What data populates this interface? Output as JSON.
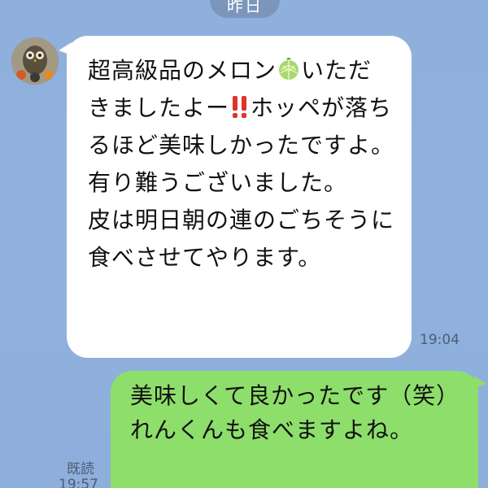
{
  "date_separator": "昨日",
  "incoming": {
    "text_part1": "超高級品のメロン",
    "emoji1": "melon-icon",
    "text_part2": "いただきましたよー",
    "emoji2": "double-exclamation-icon",
    "text_part3": "ホッペが落ちるほど美味しかったですよ。有り難うございました。\n皮は明日朝の連のごちそうに食べさせてやります。",
    "time": "19:04"
  },
  "outgoing": {
    "text": "美味しくて良かったです（笑）\nれんくんも食べますよね。",
    "read_label": "既読",
    "time": "19:57"
  },
  "colors": {
    "background": "#8fb0dc",
    "incoming_bubble": "#ffffff",
    "outgoing_bubble": "#8ede6c",
    "meta_text": "#4d5d72"
  }
}
